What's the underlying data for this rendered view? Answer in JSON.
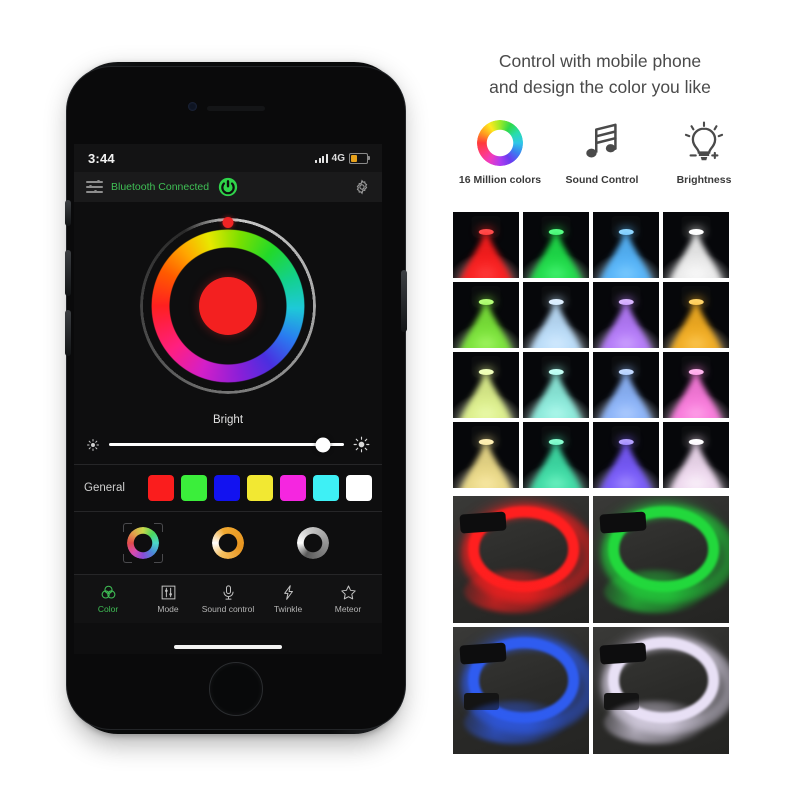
{
  "phone": {
    "status_bar": {
      "time": "3:44",
      "network": "4G",
      "signal_icon": "signal-bars-icon",
      "battery_icon": "battery-low-icon"
    },
    "app_bar": {
      "menu_icon": "menu-sliders-icon",
      "bluetooth_status": "Bluetooth Connected",
      "power_icon": "power-button-icon",
      "settings_icon": "gear-icon"
    },
    "color_wheel": {
      "selected_color": "#f32020",
      "handle_color": "#f02424",
      "handle_angle_deg": 0
    },
    "brightness": {
      "label": "Bright",
      "value_percent": 91,
      "min_icon": "sun-small-icon",
      "max_icon": "sun-large-icon"
    },
    "general": {
      "label": "General",
      "swatches": [
        {
          "name": "red",
          "hex": "#fa1d1d"
        },
        {
          "name": "green",
          "hex": "#3bee3b"
        },
        {
          "name": "blue",
          "hex": "#1212f0"
        },
        {
          "name": "yellow",
          "hex": "#f2e832"
        },
        {
          "name": "magenta",
          "hex": "#f526e0"
        },
        {
          "name": "cyan",
          "hex": "#3ef0f5"
        },
        {
          "name": "white",
          "hex": "#ffffff"
        }
      ]
    },
    "presets": [
      {
        "name": "rainbow-ring",
        "selected": true
      },
      {
        "name": "warm-ring",
        "selected": false
      },
      {
        "name": "white-ring",
        "selected": false
      }
    ],
    "tabs": [
      {
        "label": "Color",
        "icon": "color-circles-icon",
        "active": true
      },
      {
        "label": "Mode",
        "icon": "sliders-square-icon",
        "active": false
      },
      {
        "label": "Sound control",
        "icon": "microphone-icon",
        "active": false
      },
      {
        "label": "Twinkle",
        "icon": "lightning-bolt-icon",
        "active": false
      },
      {
        "label": "Meteor",
        "icon": "star-icon",
        "active": false
      }
    ]
  },
  "right_panel": {
    "headline_line1": "Control with mobile phone",
    "headline_line2": "and design the color you like",
    "features": [
      {
        "label": "16 Million colors",
        "icon": "color-wheel-icon"
      },
      {
        "label": "Sound Control",
        "icon": "music-note-icon"
      },
      {
        "label": "Brightness",
        "icon": "light-bulb-icon"
      }
    ],
    "light_grid": [
      {
        "beam": "#ff1e1e",
        "lens": "#ff4d4d"
      },
      {
        "beam": "#1fe04a",
        "lens": "#57ff86"
      },
      {
        "beam": "#57b8ff",
        "lens": "#8fd6ff"
      },
      {
        "beam": "#f2f2f2",
        "lens": "#ffffff"
      },
      {
        "beam": "#7de83a",
        "lens": "#b7ff7a"
      },
      {
        "beam": "#bfe2ff",
        "lens": "#dff0ff"
      },
      {
        "beam": "#b87dff",
        "lens": "#d9b8ff"
      },
      {
        "beam": "#f7b022",
        "lens": "#ffd46a"
      },
      {
        "beam": "#e2f58f",
        "lens": "#f0ffbd"
      },
      {
        "beam": "#8ff0e0",
        "lens": "#c4fff5"
      },
      {
        "beam": "#8fb8ff",
        "lens": "#c2d9ff"
      },
      {
        "beam": "#ff7de0",
        "lens": "#ffb8ef"
      },
      {
        "beam": "#f0de8a",
        "lens": "#fff0b5"
      },
      {
        "beam": "#3fe0a8",
        "lens": "#8affd1"
      },
      {
        "beam": "#7a5cff",
        "lens": "#b5a3ff"
      },
      {
        "beam": "#f5dff5",
        "lens": "#ffffff"
      }
    ],
    "fiber_grid": [
      {
        "color": "#ff1f1f",
        "label": "red-fiber-optic"
      },
      {
        "color": "#22d83c",
        "label": "green-fiber-optic"
      },
      {
        "color": "#2f5cf0",
        "label": "blue-fiber-optic"
      },
      {
        "color": "#e8e0f5",
        "label": "white-fiber-optic"
      }
    ]
  }
}
